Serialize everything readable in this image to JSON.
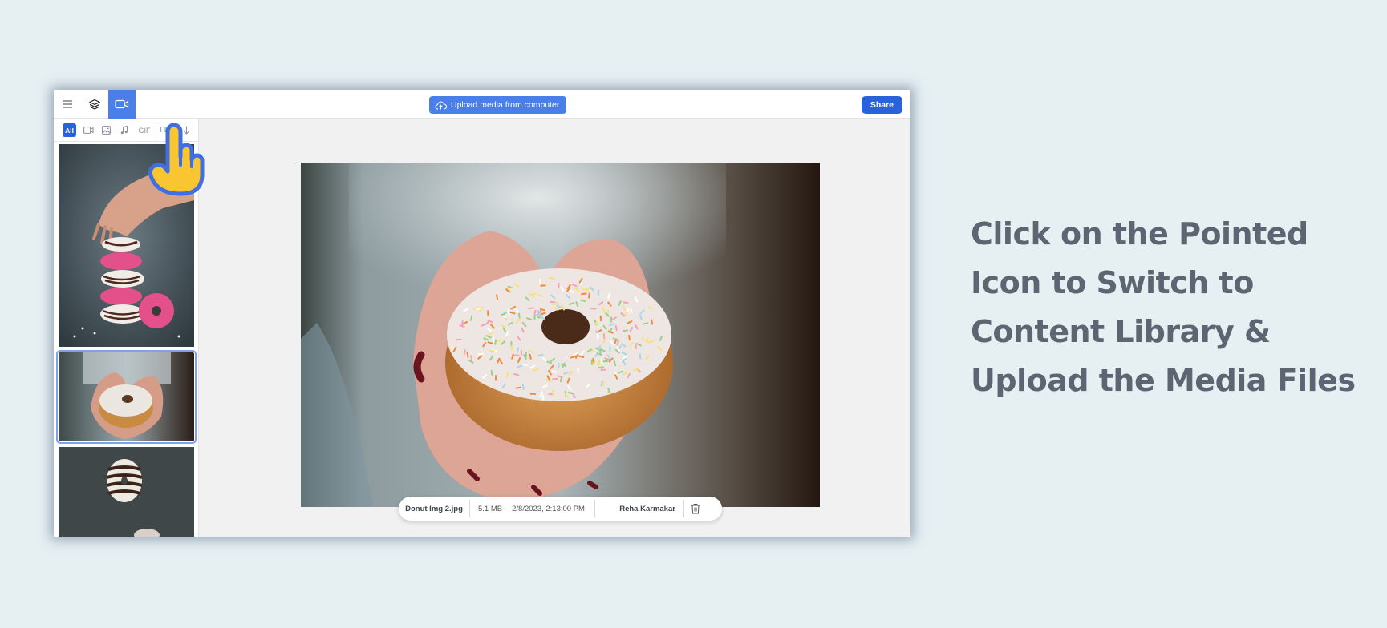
{
  "topbar": {
    "menu_icon": "hamburger-menu-icon",
    "layers_icon": "layers-icon",
    "media_icon": "video-camera-icon",
    "upload_label": "Upload media from computer",
    "upload_icon": "cloud-upload-icon",
    "share_label": "Share"
  },
  "filters": [
    {
      "label": "All",
      "active": true
    },
    {
      "icon": "video-icon"
    },
    {
      "icon": "image-icon"
    },
    {
      "icon": "audio-icon"
    },
    {
      "label": "GIF"
    },
    {
      "label": "Tт"
    },
    {
      "icon": "sort-down-arrow-icon"
    }
  ],
  "library": {
    "items": [
      {
        "name": "Donut stack",
        "selected": false
      },
      {
        "name": "Donut Img 2.jpg",
        "selected": true
      },
      {
        "name": "Floating striped donut",
        "selected": false
      }
    ]
  },
  "preview": {
    "file_name": "Donut Img 2.jpg",
    "file_size": "5.1 MB",
    "timestamp": "2/8/2023, 2:13:00 PM",
    "author": "Reha Karmakar",
    "delete_icon": "trash-icon"
  },
  "caption": {
    "lines": [
      "Click on the Pointed",
      "Icon to Switch to",
      "Content Library &",
      "Upload the Media Files"
    ]
  },
  "colors": {
    "accent": "#4a7fea",
    "share": "#2a63d9",
    "background": "#e6f0f3",
    "caption": "#5d6573",
    "pointer_fill": "#f9c530",
    "pointer_stroke": "#3f6fe0"
  }
}
